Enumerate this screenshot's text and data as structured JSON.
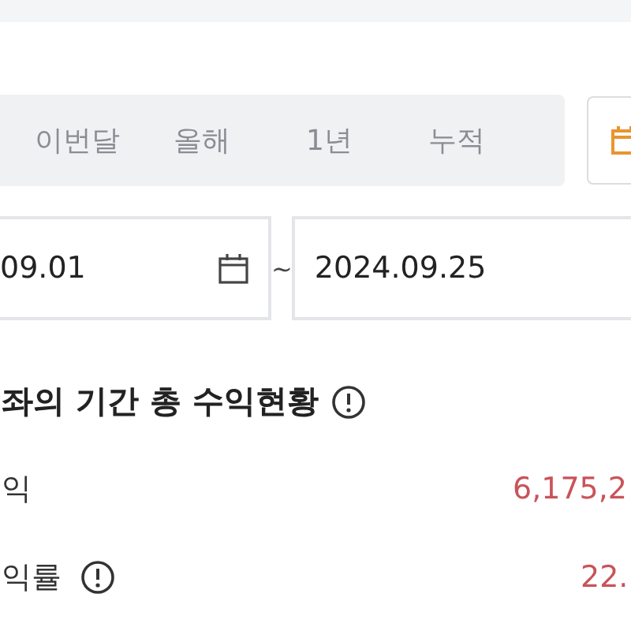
{
  "period_tabs": [
    {
      "label": "이번달",
      "selected": false
    },
    {
      "label": "올해",
      "selected": false
    },
    {
      "label": "1년",
      "selected": false
    },
    {
      "label": "누적",
      "selected": false
    }
  ],
  "date_range": {
    "start": "09.01",
    "separator": "~",
    "end": "2024.09.25"
  },
  "summary": {
    "title": "좌의 기간 총 수익현황",
    "rows": [
      {
        "label": "익",
        "value": "6,175,2",
        "info": false
      },
      {
        "label": "익률",
        "value": "22.",
        "info": true
      }
    ]
  }
}
